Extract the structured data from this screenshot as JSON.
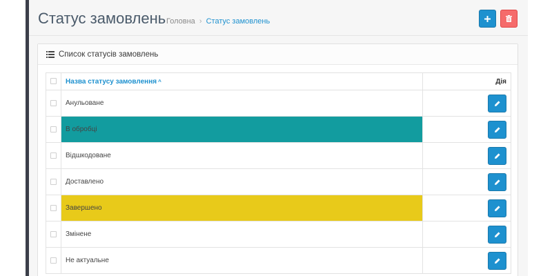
{
  "header": {
    "title": "Статус замовлень",
    "breadcrumb": {
      "home": "Головна",
      "separator": "›",
      "current": "Статус замовлень"
    },
    "add_button_icon": "plus-icon",
    "delete_button_icon": "trash-icon"
  },
  "panel": {
    "heading": "Список статусів замовлень",
    "heading_icon": "list-icon"
  },
  "table": {
    "columns": {
      "name": "Назва статусу замовлення",
      "action": "Дія"
    },
    "sort_indicator": "^",
    "rows": [
      {
        "name": "Анульоване",
        "highlight": ""
      },
      {
        "name": "В обробці",
        "highlight": "#129c9f"
      },
      {
        "name": "Відшкодоване",
        "highlight": ""
      },
      {
        "name": "Доставлено",
        "highlight": ""
      },
      {
        "name": "Завершено",
        "highlight": "#e8ca1a"
      },
      {
        "name": "Змінене",
        "highlight": ""
      },
      {
        "name": "Не актуальне",
        "highlight": ""
      }
    ]
  },
  "colors": {
    "primary": "#1e91cf",
    "danger": "#f56b6b",
    "sidebar": "#3c3f4a"
  }
}
